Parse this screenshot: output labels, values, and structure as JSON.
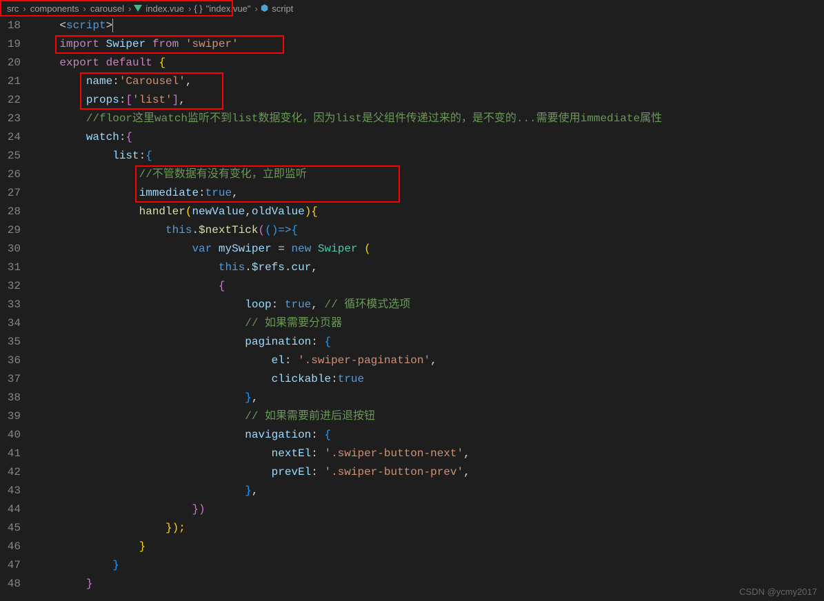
{
  "breadcrumb": {
    "p1": "src",
    "p2": "components",
    "p3": "carousel",
    "p4": "index.vue",
    "p5": "\"index.vue\"",
    "p6": "script"
  },
  "lines": {
    "start": 18,
    "end": 48
  },
  "code": {
    "l18": {
      "ind": "    ",
      "lt": "<",
      "tag": "script",
      "gt": ">"
    },
    "l19": {
      "ind": "    ",
      "imp": "import",
      "name": "Swiper",
      "from": "from",
      "str": "'swiper'"
    },
    "l20": {
      "ind": "    ",
      "exp": "export",
      "def": "default",
      "ob": "{"
    },
    "l21": {
      "ind": "        ",
      "key": "name",
      "col": ":",
      "val": "'Carousel'",
      "com": ","
    },
    "l22": {
      "ind": "        ",
      "key": "props",
      "col": ":",
      "ob": "[",
      "val": "'list'",
      "cb": "]",
      "com": ","
    },
    "l23": {
      "ind": "        ",
      "cmt": "//floor这里watch监听不到list数据变化，因为list是父组件传递过来的，是不变的...需要使用immediate属性"
    },
    "l24": {
      "ind": "        ",
      "key": "watch",
      "col": ":",
      "ob": "{"
    },
    "l25": {
      "ind": "            ",
      "key": "list",
      "col": ":",
      "ob": "{"
    },
    "l26": {
      "ind": "                ",
      "cmt": "//不管数据有没有变化，立即监听"
    },
    "l27": {
      "ind": "                ",
      "key": "immediate",
      "col": ":",
      "val": "true",
      "com": ","
    },
    "l28": {
      "ind": "                ",
      "fn": "handler",
      "op": "(",
      "a1": "newValue",
      "c1": ",",
      "a2": "oldValue",
      "cp": ")",
      "ob": "{"
    },
    "l29": {
      "ind": "                    ",
      "th": "this",
      "dot": ".",
      "fn": "$nextTick",
      "op": "(",
      "o2": "(",
      "c2": ")",
      "ar": "=>",
      "ob": "{"
    },
    "l30": {
      "ind": "                        ",
      "var": "var",
      "name": "mySwiper",
      "eq": " = ",
      "new": "new",
      "cls": "Swiper",
      "ob": " ("
    },
    "l31": {
      "ind": "                            ",
      "th": "this",
      "d1": ".",
      "r": "$refs",
      "d2": ".",
      "c": "cur",
      "com": ","
    },
    "l32": {
      "ind": "                            ",
      "ob": "{"
    },
    "l33": {
      "ind": "                                ",
      "key": "loop",
      "col": ": ",
      "val": "true",
      "com": ",",
      "cmt": " // 循环模式选项"
    },
    "l34": {
      "ind": "                                ",
      "cmt": "// 如果需要分页器"
    },
    "l35": {
      "ind": "                                ",
      "key": "pagination",
      "col": ": ",
      "ob": "{"
    },
    "l36": {
      "ind": "                                    ",
      "key": "el",
      "col": ": ",
      "val": "'.swiper-pagination'",
      "com": ","
    },
    "l37": {
      "ind": "                                    ",
      "key": "clickable",
      "col": ":",
      "val": "true"
    },
    "l38": {
      "ind": "                                ",
      "cb": "}",
      "com": ","
    },
    "l39": {
      "ind": "                                ",
      "cmt": "// 如果需要前进后退按钮"
    },
    "l40": {
      "ind": "                                ",
      "key": "navigation",
      "col": ": ",
      "ob": "{"
    },
    "l41": {
      "ind": "                                    ",
      "key": "nextEl",
      "col": ": ",
      "val": "'.swiper-button-next'",
      "com": ","
    },
    "l42": {
      "ind": "                                    ",
      "key": "prevEl",
      "col": ": ",
      "val": "'.swiper-button-prev'",
      "com": ","
    },
    "l43": {
      "ind": "                                ",
      "cb": "}",
      "com": ","
    },
    "l44": {
      "ind": "                        ",
      "cb": "})"
    },
    "l45": {
      "ind": "                    ",
      "cb": "});"
    },
    "l46": {
      "ind": "                ",
      "cb": "}"
    },
    "l47": {
      "ind": "            ",
      "cb": "}"
    },
    "l48": {
      "ind": "        ",
      "cb": "}"
    }
  },
  "watermark": "CSDN @ycmy2017"
}
